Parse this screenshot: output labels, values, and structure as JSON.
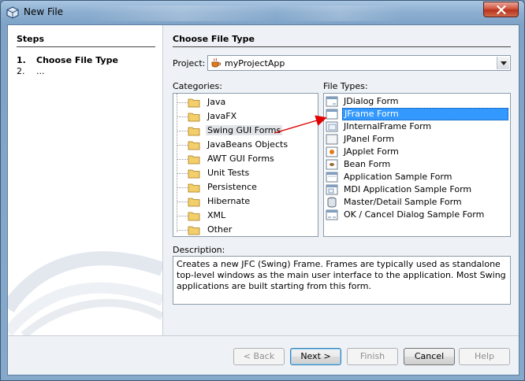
{
  "window": {
    "title": "New File"
  },
  "steps": {
    "heading": "Steps",
    "items": [
      {
        "num": "1.",
        "label": "Choose File Type"
      },
      {
        "num": "2.",
        "label": "..."
      }
    ]
  },
  "main": {
    "heading": "Choose File Type",
    "project_label": "Project:",
    "project_value": "myProjectApp",
    "categories_label": "Categories:",
    "file_types_label": "File Types:",
    "categories": [
      "Java",
      "JavaFX",
      "Swing GUI Forms",
      "JavaBeans Objects",
      "AWT GUI Forms",
      "Unit Tests",
      "Persistence",
      "Hibernate",
      "XML",
      "Other"
    ],
    "selected_category": "Swing GUI Forms",
    "file_types": [
      "JDialog Form",
      "JFrame Form",
      "JInternalFrame Form",
      "JPanel Form",
      "JApplet Form",
      "Bean Form",
      "Application Sample Form",
      "MDI Application Sample Form",
      "Master/Detail Sample Form",
      "OK / Cancel Dialog Sample Form"
    ],
    "selected_file_type": "JFrame Form",
    "description_label": "Description:",
    "description": "Creates a new JFC (Swing) Frame. Frames are typically used as standalone top-level windows as the main user interface to the application. Most Swing applications are built starting from this form."
  },
  "buttons": {
    "back": "< Back",
    "next": "Next >",
    "finish": "Finish",
    "cancel": "Cancel",
    "help": "Help"
  },
  "colors": {
    "selection": "#3399ff",
    "annotation_arrow": "#e00000"
  }
}
